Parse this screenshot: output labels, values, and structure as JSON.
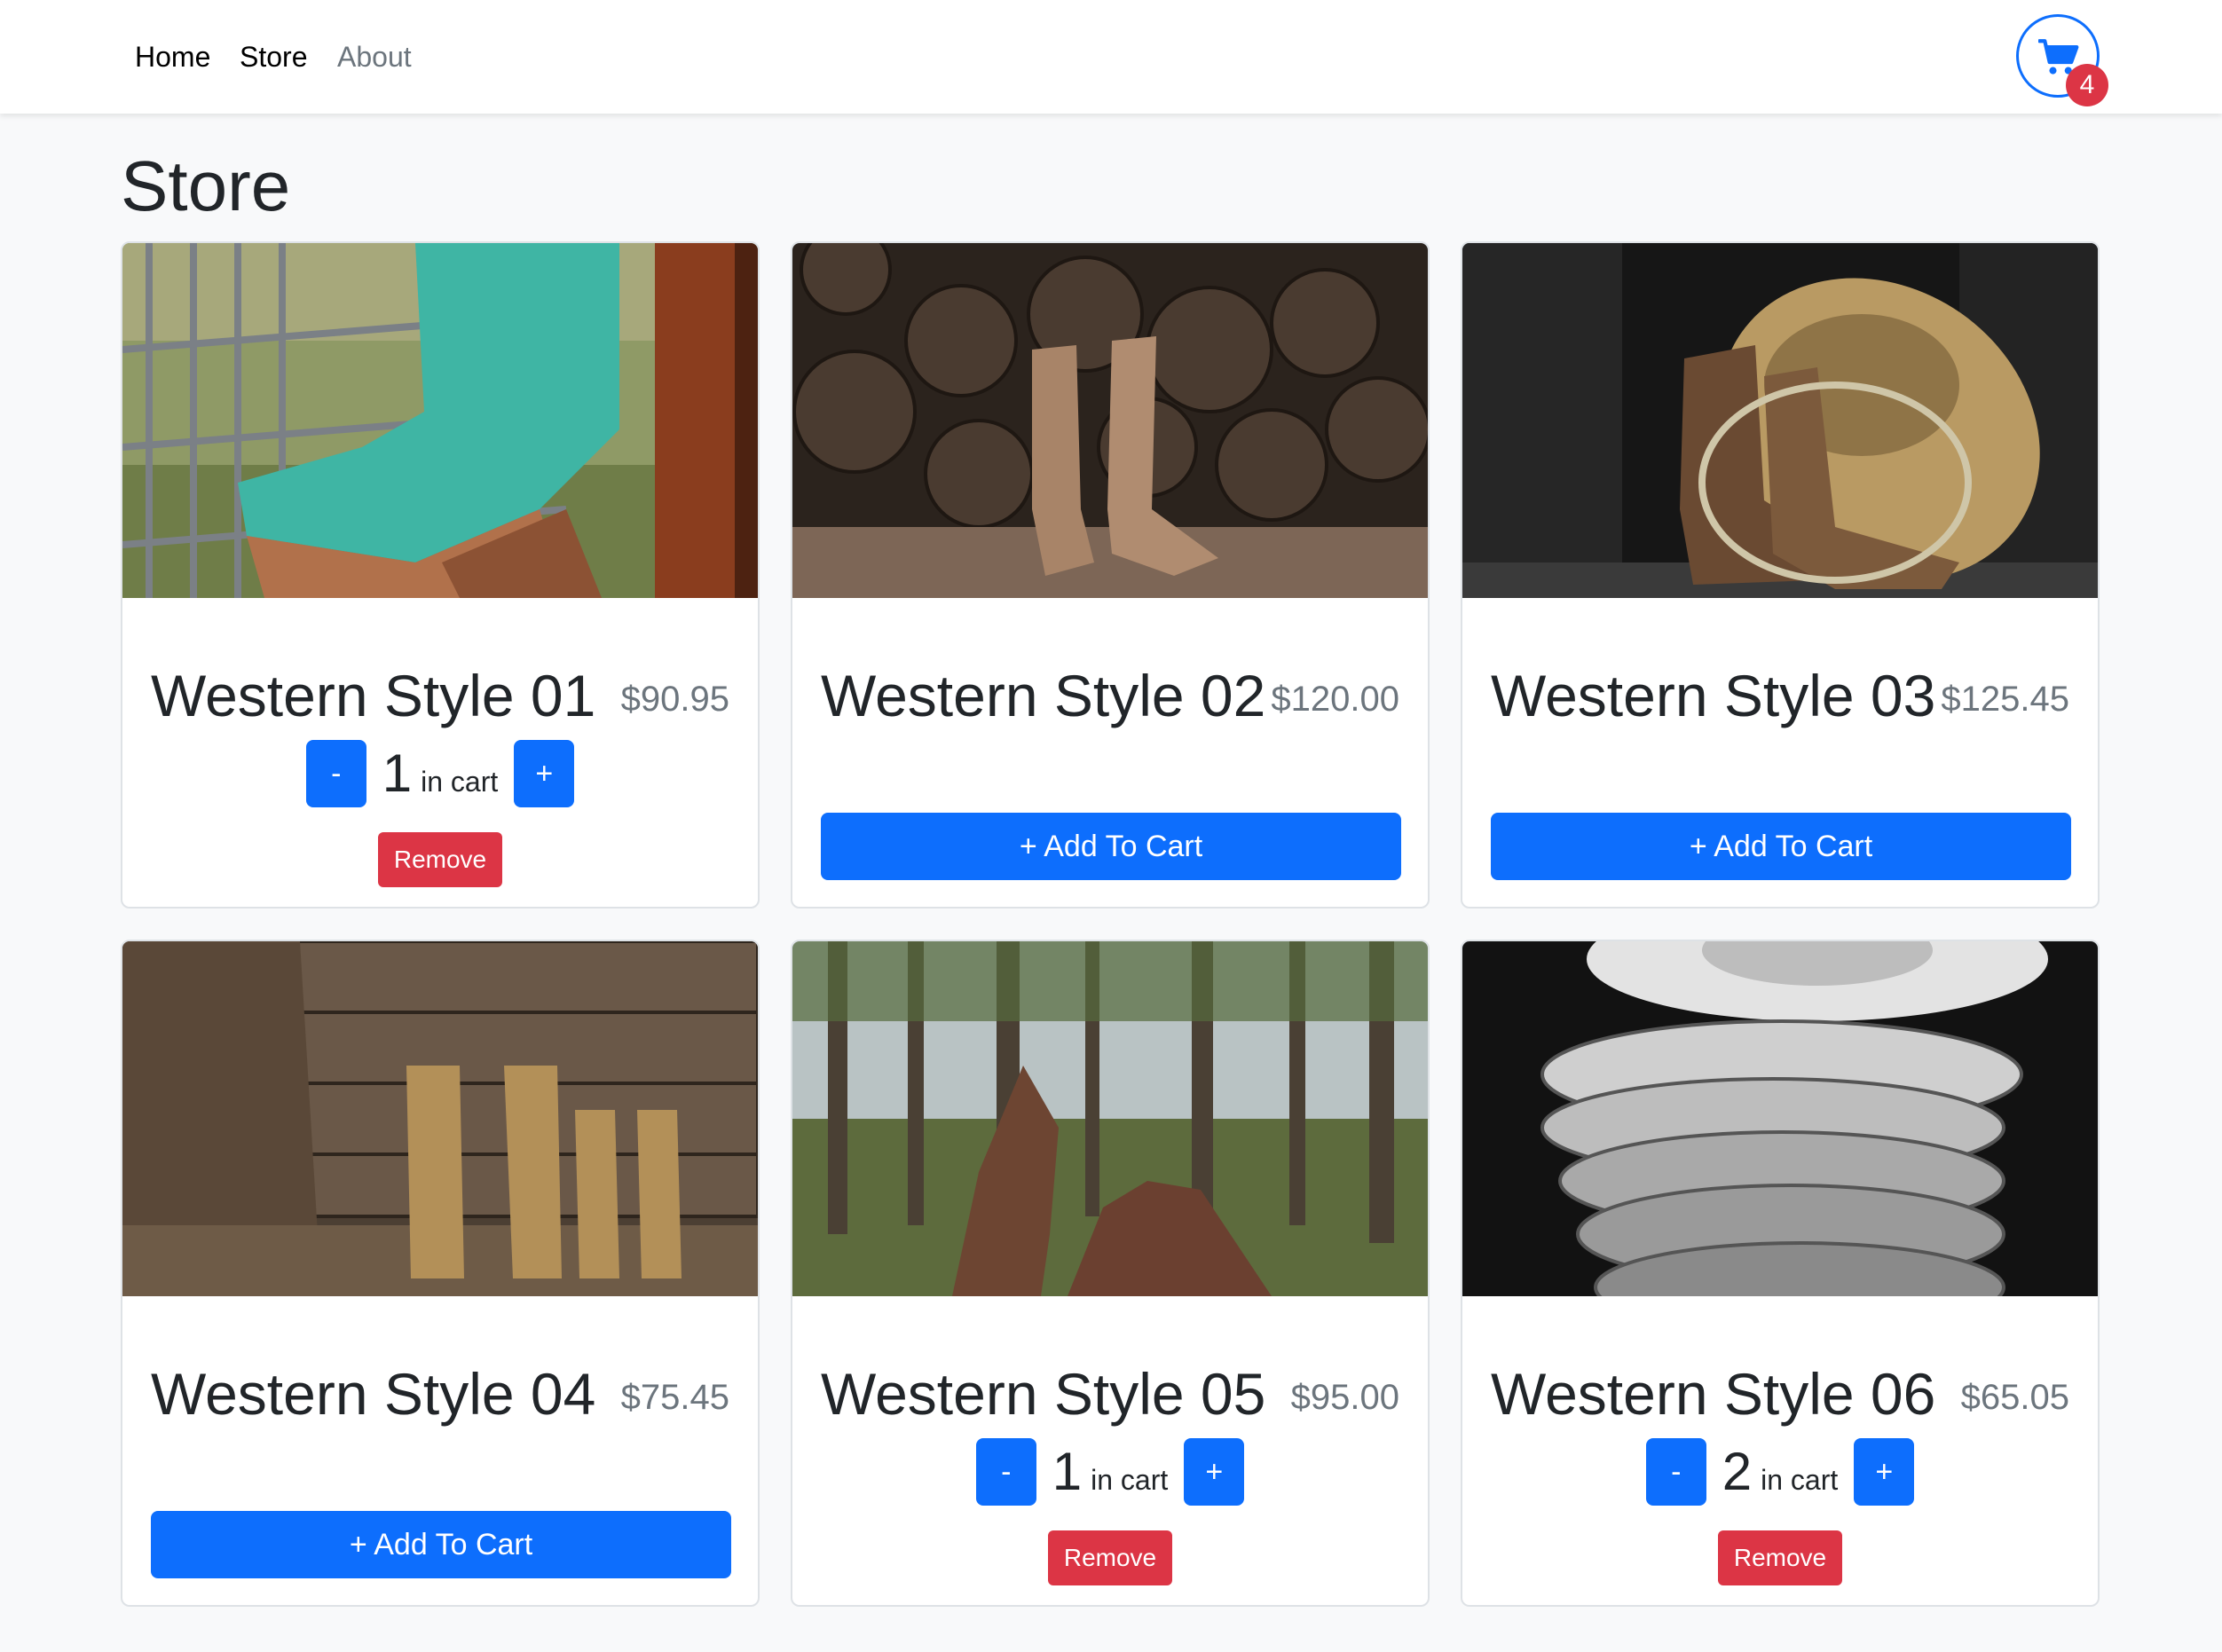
{
  "nav": {
    "home": "Home",
    "store": "Store",
    "about": "About",
    "cart_count": "4",
    "cart_icon": "cart-icon"
  },
  "page": {
    "title": "Store"
  },
  "products": [
    {
      "name": "Western Style 01",
      "price": "$90.95",
      "qty": "1",
      "qty_label": "in cart",
      "remove_label": "Remove",
      "in_cart": true
    },
    {
      "name": "Western Style 02",
      "price": "$120.00",
      "add_label": "+ Add To Cart",
      "in_cart": false
    },
    {
      "name": "Western Style 03",
      "price": "$125.45",
      "add_label": "+ Add To Cart",
      "in_cart": false
    },
    {
      "name": "Western Style 04",
      "price": "$75.45",
      "add_label": "+ Add To Cart",
      "in_cart": false
    },
    {
      "name": "Western Style 05",
      "price": "$95.00",
      "qty": "1",
      "qty_label": "in cart",
      "remove_label": "Remove",
      "in_cart": true
    },
    {
      "name": "Western Style 06",
      "price": "$65.05",
      "qty": "2",
      "qty_label": "in cart",
      "remove_label": "Remove",
      "in_cart": true
    }
  ],
  "controls": {
    "decrement": "-",
    "increment": "+"
  },
  "colors": {
    "primary": "#0d6efd",
    "danger": "#dc3545",
    "muted": "#6c757d"
  }
}
